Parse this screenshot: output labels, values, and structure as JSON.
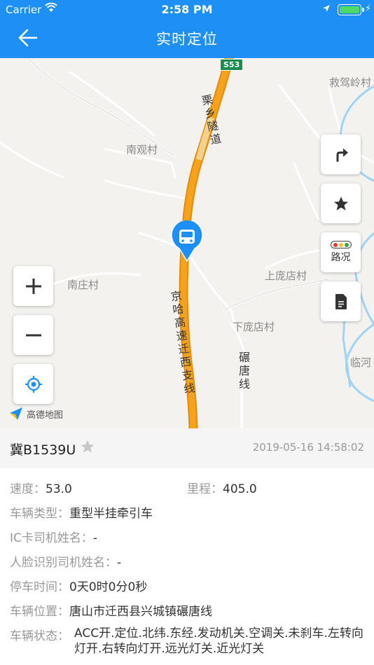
{
  "status_bar": {
    "carrier": "Carrier",
    "time": "2:58 PM",
    "battery_level": 1.0
  },
  "nav": {
    "title": "实时定位"
  },
  "map": {
    "highway_shield": "S53",
    "labels": {
      "jiujialing": "救驾岭村",
      "nanguan": "南观村",
      "nanzhuang": "南庄村",
      "shangpang": "上庞店村",
      "xiapang": "下庞店村",
      "linhe": "临河"
    },
    "road_labels": {
      "lixiang_tunnel": "栗乡隧道",
      "jingha": "京哈高速迁西支线",
      "niantang": "碾唐线"
    },
    "buttons": {
      "traffic_label": "路况"
    },
    "logo_text": "高德地图"
  },
  "vehicle": {
    "plate": "冀B1539U",
    "timestamp": "2019-05-16 14:58:02",
    "speed_label": "速度：",
    "speed": "53.0",
    "mileage_label": "里程：",
    "mileage": "405.0",
    "type_label": "车辆类型：",
    "type": "重型半挂牵引车",
    "ic_driver_label": "IC卡司机姓名：",
    "ic_driver": "-",
    "face_driver_label": "人脸识别司机姓名：",
    "face_driver": "-",
    "park_time_label": "停车时间：",
    "park_time": "0天0时0分0秒",
    "location_label": "车辆位置：",
    "location": "唐山市迁西县兴城镇碾唐线",
    "status_label": "车辆状态：",
    "status": "ACC开.定位.北纬.东经.发动机关.空调关.未刹车.左转向灯开.右转向灯开.远光灯关.近光灯关"
  },
  "colors": {
    "header": "#1e90f5",
    "route": "#f7a21b",
    "marker": "#1e90f5",
    "water": "#9fd3f5"
  }
}
